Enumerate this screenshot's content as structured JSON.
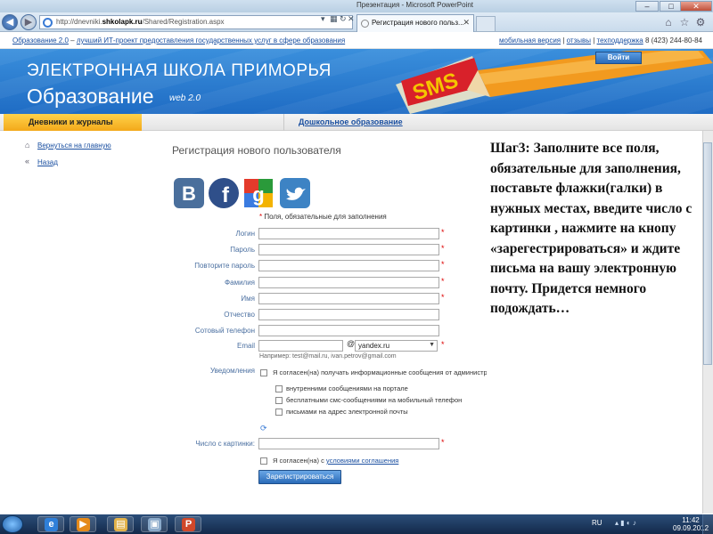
{
  "browser": {
    "window_title": "Презентация - Microsoft PowerPoint",
    "url_prefix": "http://dnevniki.",
    "url_domain": "shkolapk.ru",
    "url_path": "/Shared/Registration.aspx",
    "tab_active_label": "Регистрация нового польз...",
    "back_symbol": "◀",
    "forward_symbol": "▶",
    "minimize_symbol": "–",
    "maximize_symbol": "□",
    "close_symbol": "✕",
    "tab_close_symbol": "✕"
  },
  "toplinks": {
    "brand": "Образование 2.0",
    "dash": " – ",
    "tagline": "лучший ИТ-проект предоставления государственных услуг в сфере образования",
    "mobile": "мобильная версия",
    "reviews": "отзывы",
    "support": "техподдержка",
    "phone": "8 (423) 244-80-84",
    "sep": " | "
  },
  "banner": {
    "title_line1": "ЭЛЕКТРОННАЯ ШКОЛА ПРИМОРЬЯ",
    "title_line2": "Образование",
    "version": "web 2.0",
    "sms_label": "SMS",
    "login_button": "Войти"
  },
  "tabs": {
    "diary": "Дневники и журналы",
    "preschool": "Дошкольное образование"
  },
  "sidebar": {
    "home_link": "Вернуться на главную",
    "back_link": "Назад"
  },
  "form": {
    "title": "Регистрация нового пользователя",
    "required_star": "*",
    "required_note": "Поля, обязательные для заполнения",
    "fields": {
      "login": "Логин",
      "password": "Пароль",
      "repeat_password": "Повторите пароль",
      "surname": "Фамилия",
      "name": "Имя",
      "patronymic": "Отчество",
      "phone": "Сотовый телефон",
      "email": "Email"
    },
    "email_at": "@",
    "email_domain": "yandex.ru",
    "email_hint": "Например: test@mail.ru, ivan.petrov@gmail.com",
    "notifications_label": "Уведомления",
    "consent_notifications": "Я согласен(на) получать информационные сообщения от администрации портала",
    "notify_options": [
      "внутренними сообщениями на портале",
      "бесплатными смс-сообщениями на мобильный телефон",
      "письмами на адрес электронной почты"
    ],
    "captcha_label": "Число с картинки:",
    "agree_prefix": "Я согласен(на) с ",
    "agree_link": "условиями соглашения",
    "submit": "Зарегистрироваться"
  },
  "social": {
    "vk": "B",
    "facebook": "f",
    "google": "g",
    "twitter": "🐦"
  },
  "instruction": {
    "text": "Шаг3: Заполните все поля, обязательные для заполнения, поставьте флажки(галки) в нужных местах, введите число с картинки , нажмите на кнопу «зарегестрироваться» и ждите письма на вашу электронную почту. Придется немного подождать…"
  },
  "taskbar": {
    "lang": "RU",
    "time": "11:42",
    "date": "09.09.2012"
  },
  "colors": {
    "banner_blue": "#2a7fd4",
    "tab_yellow": "#f5b21f",
    "link_blue": "#1a4fa0",
    "required_red": "#dd0000",
    "taskbar": "#1c3860"
  }
}
